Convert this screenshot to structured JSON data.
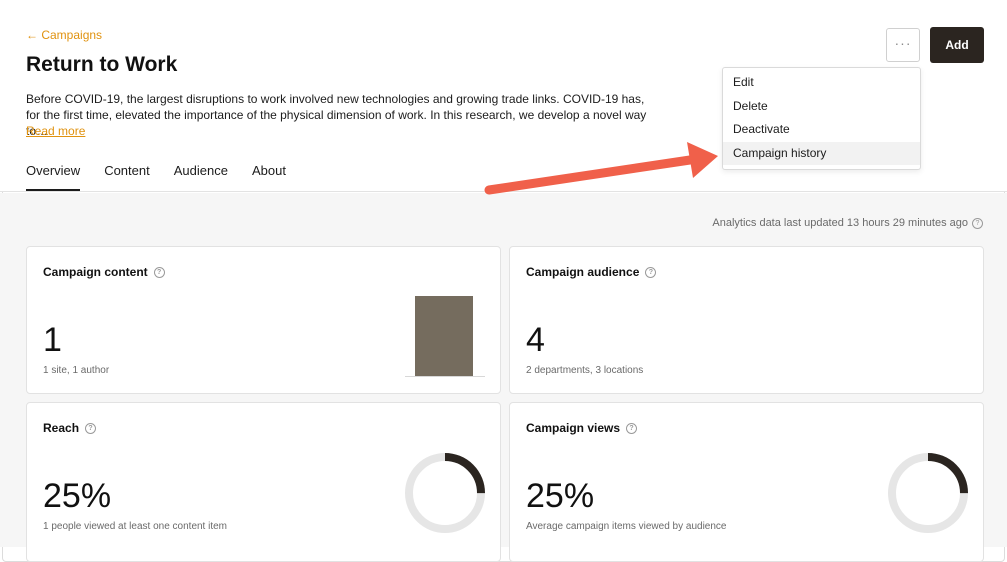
{
  "header": {
    "breadcrumb": "Campaigns",
    "title": "Return to Work",
    "description": "Before COVID-19, the largest disruptions to work involved new technologies and growing trade links. COVID-19 has, for the first time, elevated the importance of the physical dimension of work. In this research, we develop a novel way to…",
    "read_more": "Read more",
    "more_icon": "ellipsis-icon",
    "add_label": "Add"
  },
  "menu": {
    "items": [
      "Edit",
      "Delete",
      "Deactivate",
      "Campaign history"
    ],
    "highlighted": "Campaign history"
  },
  "tabs": [
    "Overview",
    "Content",
    "Audience",
    "About"
  ],
  "active_tab": "Overview",
  "analytics_note": "Analytics data last updated 13 hours 29 minutes ago",
  "cards": {
    "content": {
      "title": "Campaign content",
      "value": "1",
      "subtitle": "1 site, 1 author",
      "chart_color": "#756c5e"
    },
    "audience": {
      "title": "Campaign audience",
      "value": "4",
      "subtitle": "2 departments, 3 locations"
    },
    "reach": {
      "title": "Reach",
      "value": "25%",
      "subtitle": "1 people viewed at least one content item",
      "fraction": 0.25
    },
    "views": {
      "title": "Campaign views",
      "value": "25%",
      "subtitle": "Average campaign items viewed by audience",
      "fraction": 0.25
    }
  },
  "colors": {
    "accent": "#e0920f",
    "primary_button": "#2b2520",
    "annotation_arrow": "#f0604a",
    "donut_track": "#e6e6e6",
    "donut_fill": "#2b2520"
  },
  "chart_data": {
    "type": "bar",
    "categories": [
      ""
    ],
    "values": [
      1
    ]
  }
}
